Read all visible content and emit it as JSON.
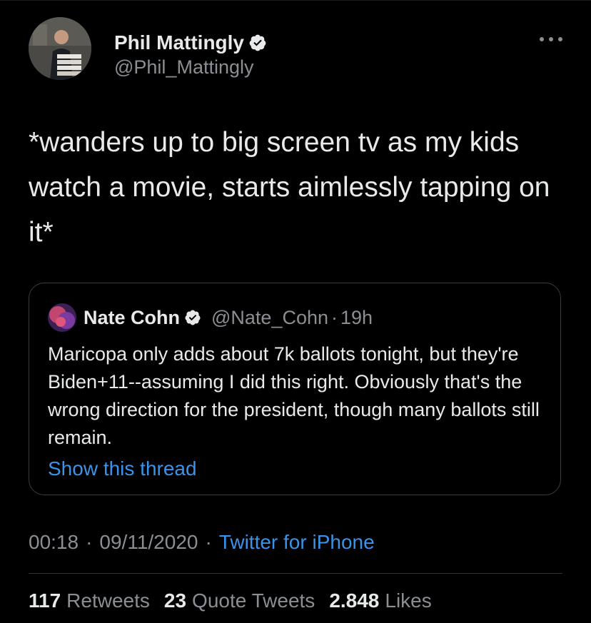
{
  "author": {
    "name": "Phil Mattingly",
    "handle": "@Phil_Mattingly"
  },
  "tweet": {
    "text": "*wanders up to big screen tv as my kids watch a movie, starts aimlessly tapping on it*"
  },
  "quote": {
    "name": "Nate Cohn",
    "handle": "@Nate_Cohn",
    "dot": "·",
    "time": "19h",
    "text": "Maricopa only adds about 7k ballots tonight, but they're Biden+11--assuming I did this right. Obviously that's the wrong direction for the president, though many ballots still remain.",
    "show_thread": "Show this thread"
  },
  "meta": {
    "time": "00:18",
    "sep1": "·",
    "date": "09/11/2020",
    "sep2": "·",
    "source": "Twitter for iPhone"
  },
  "stats": {
    "retweets_count": "117",
    "retweets_label": "Retweets",
    "quotes_count": "23",
    "quotes_label": "Quote Tweets",
    "likes_count": "2.848",
    "likes_label": "Likes"
  },
  "colors": {
    "background": "#000000",
    "link": "#3a93e8",
    "secondary_text": "#8b8f93",
    "verified": "#e7e9ea"
  },
  "icons": {
    "verified": "verified-badge-icon",
    "more": "more-options-icon"
  }
}
